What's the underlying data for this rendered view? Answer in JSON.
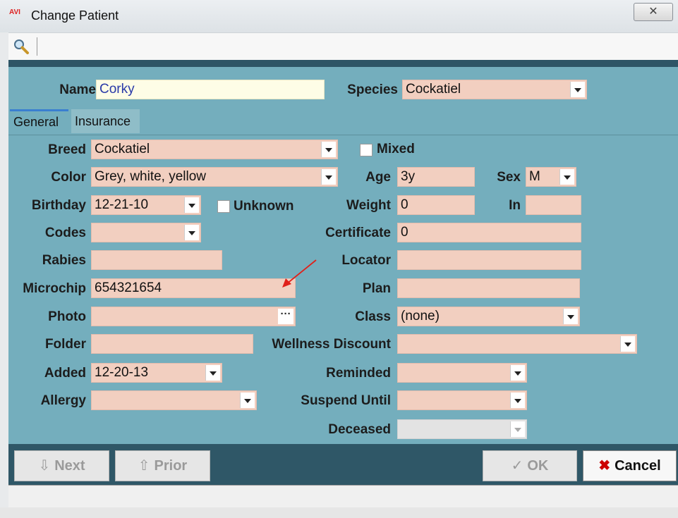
{
  "window": {
    "title": "Change Patient",
    "logo_text": "AVI",
    "close_glyph": "✕"
  },
  "toolbar": {
    "search_icon": "search-icon"
  },
  "header": {
    "name_label": "Name",
    "name_value": "Corky",
    "species_label": "Species",
    "species_value": "Cockatiel"
  },
  "tabs": [
    {
      "label": "General"
    },
    {
      "label": "Insurance"
    }
  ],
  "left": {
    "breed_label": "Breed",
    "breed_value": "Cockatiel",
    "color_label": "Color",
    "color_value": "Grey, white, yellow",
    "birthday_label": "Birthday",
    "birthday_value": "12-21-10",
    "unknown_label": "Unknown",
    "codes_label": "Codes",
    "codes_value": "",
    "rabies_label": "Rabies",
    "rabies_value": "",
    "microchip_label": "Microchip",
    "microchip_value": "654321654",
    "photo_label": "Photo",
    "photo_value": "",
    "photo_button": "···",
    "folder_label": "Folder",
    "folder_value": "",
    "added_label": "Added",
    "added_value": "12-20-13",
    "allergy_label": "Allergy",
    "allergy_value": ""
  },
  "right": {
    "mixed_label": "Mixed",
    "age_label": "Age",
    "age_value": "3y",
    "sex_label": "Sex",
    "sex_value": "M",
    "weight_label": "Weight",
    "weight_value": "0",
    "in_label": "In",
    "in_value": "",
    "certificate_label": "Certificate",
    "certificate_value": "0",
    "locator_label": "Locator",
    "locator_value": "",
    "plan_label": "Plan",
    "plan_value": "",
    "class_label": "Class",
    "class_value": "(none)",
    "wellness_label": "Wellness Discount",
    "wellness_value": "",
    "reminded_label": "Reminded",
    "reminded_value": "",
    "suspend_label": "Suspend Until",
    "suspend_value": "",
    "deceased_label": "Deceased",
    "deceased_value": ""
  },
  "buttons": {
    "next_label": "Next",
    "next_icon": "⇩",
    "prior_label": "Prior",
    "prior_icon": "⇧",
    "ok_label": "OK",
    "ok_icon": "✓",
    "cancel_label": "Cancel",
    "cancel_icon": "✖"
  },
  "colors": {
    "panel": "#74aebd",
    "field": "#f2cfc0",
    "name_field": "#fefde6",
    "bar": "#2f5767"
  }
}
